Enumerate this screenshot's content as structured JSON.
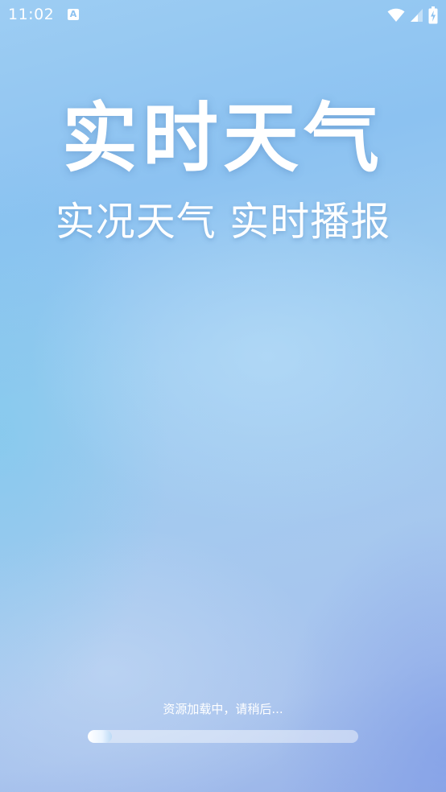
{
  "status_bar": {
    "time": "11:02",
    "app_icon": "A",
    "icons": [
      "wifi-icon",
      "cellular-signal-icon",
      "battery-charging-icon"
    ]
  },
  "splash": {
    "title": "实时天气",
    "subtitle": "实况天气 实时播报"
  },
  "loading": {
    "text": "资源加载中，请稍后...",
    "progress": 0.09
  },
  "colors": {
    "text": "#ffffff",
    "background_top": "#9dcdf3",
    "background_bottom": "#97b1e8"
  }
}
